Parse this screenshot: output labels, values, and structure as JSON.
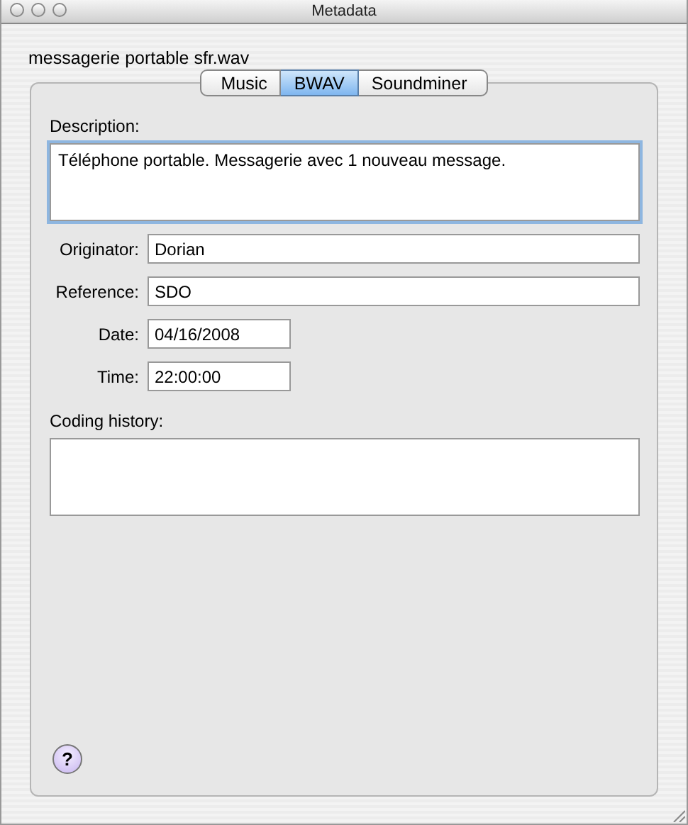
{
  "window": {
    "title": "Metadata"
  },
  "filename": "messagerie portable sfr.wav",
  "tabs": [
    {
      "label": "Music",
      "selected": false
    },
    {
      "label": "BWAV",
      "selected": true
    },
    {
      "label": "Soundminer",
      "selected": false
    }
  ],
  "description": {
    "label": "Description:",
    "value": "Téléphone portable. Messagerie avec 1 nouveau message.",
    "focused": true
  },
  "fields": [
    {
      "label": "Originator:",
      "value": "Dorian",
      "kind": "wide"
    },
    {
      "label": "Reference:",
      "value": "SDO",
      "kind": "wide"
    },
    {
      "label": "Date:",
      "value": "04/16/2008",
      "kind": "short"
    },
    {
      "label": "Time:",
      "value": "22:00:00",
      "kind": "short"
    }
  ],
  "coding_history": {
    "label": "Coding history:",
    "focused": false
  },
  "help_button": {
    "label": "?"
  }
}
